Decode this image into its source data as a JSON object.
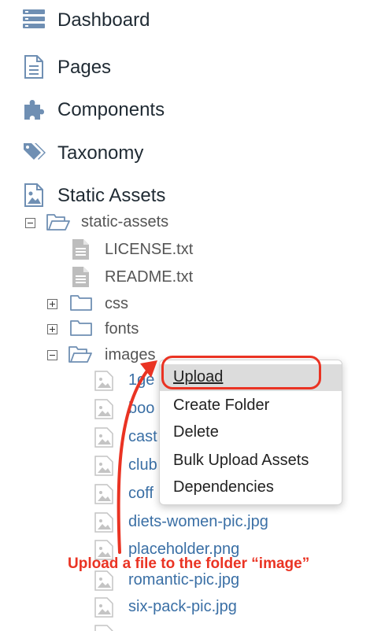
{
  "nav": {
    "dashboard": "Dashboard",
    "pages": "Pages",
    "components": "Components",
    "taxonomy": "Taxonomy",
    "static_assets": "Static Assets"
  },
  "tree": {
    "root": "static-assets",
    "license": "LICENSE.txt",
    "readme": "README.txt",
    "css": "css",
    "fonts": "fonts",
    "images": "images",
    "files": [
      "1ge",
      "boo",
      "cast",
      "club",
      "coff",
      "diets-women-pic.jpg",
      "placeholder.png",
      "romantic-pic.jpg",
      "six-pack-pic.jpg"
    ]
  },
  "context_menu": {
    "items": [
      "Upload",
      "Create Folder",
      "Delete",
      "Bulk Upload Assets",
      "Dependencies"
    ],
    "active": "Upload"
  },
  "annotation": {
    "text": "Upload a file to the folder “image”",
    "color": "#ea3323"
  },
  "colors": {
    "icon": "#6f8fb3",
    "link": "#3a6fa5",
    "text": "#1f2a33"
  },
  "icons": [
    "dashboard-icon",
    "pages-icon",
    "components-icon",
    "taxonomy-icon",
    "static-assets-icon",
    "folder-icon",
    "file-icon",
    "image-file-icon"
  ]
}
